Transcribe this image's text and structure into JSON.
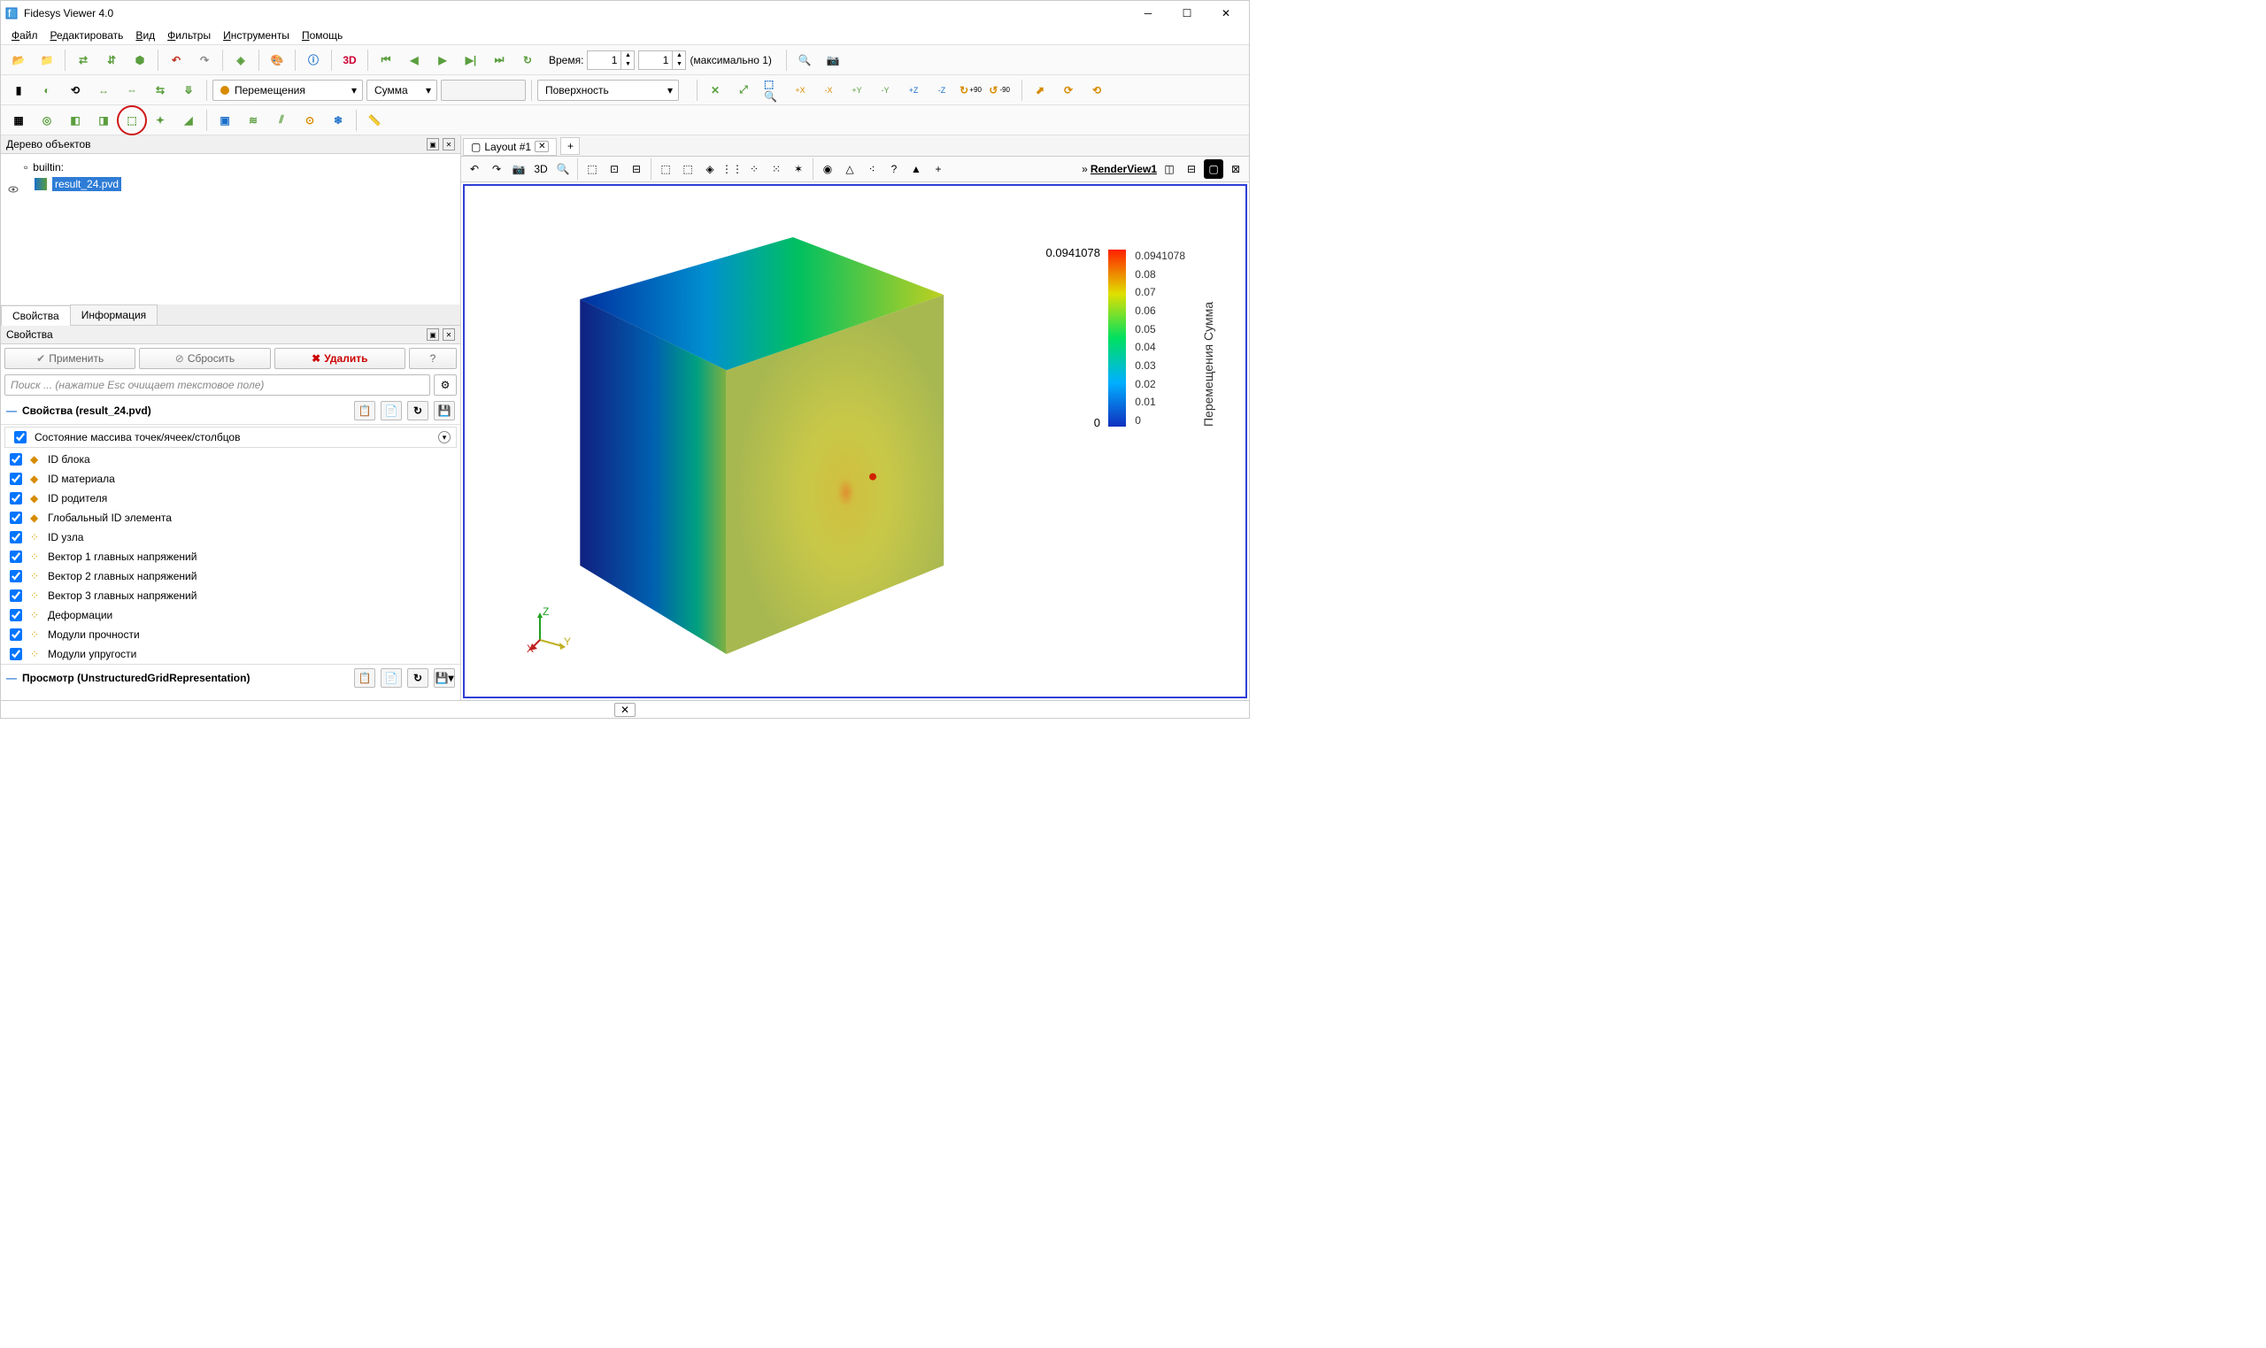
{
  "title": "Fidesys Viewer 4.0",
  "menu": [
    "Файл",
    "Редактировать",
    "Вид",
    "Фильтры",
    "Инструменты",
    "Помощь"
  ],
  "time": {
    "label": "Время:",
    "val1": "1",
    "val2": "1",
    "max": "(максимально 1)"
  },
  "fieldDropdown": "Перемещения",
  "componentDropdown": "Сумма",
  "reprDropdown": "Поверхность",
  "axisBtns": [
    "+X",
    "-X",
    "+Y",
    "-Y",
    "+Z",
    "-Z",
    "+90",
    "-90"
  ],
  "tree": {
    "title": "Дерево объектов",
    "root": "builtin:",
    "item": "result_24.pvd"
  },
  "tabs": {
    "props": "Свойства",
    "info": "Информация"
  },
  "propsTitle": "Свойства",
  "btns": {
    "apply": "Применить",
    "reset": "Сбросить",
    "delete": "Удалить",
    "help": "?"
  },
  "searchPlaceholder": "Поиск ... (нажатие Esc очищает текстовое поле)",
  "section1": "Свойства (result_24.pvd)",
  "arrayHeader": "Состояние массива точек/ячеек/столбцов",
  "arrays": [
    {
      "t": "cell",
      "l": "ID блока"
    },
    {
      "t": "cell",
      "l": "ID материала"
    },
    {
      "t": "cell",
      "l": "ID родителя"
    },
    {
      "t": "cell",
      "l": "Глобальный ID элемента"
    },
    {
      "t": "point",
      "l": "ID узла"
    },
    {
      "t": "point",
      "l": "Вектор 1 главных напряжений"
    },
    {
      "t": "point",
      "l": "Вектор 2 главных напряжений"
    },
    {
      "t": "point",
      "l": "Вектор 3 главных напряжений"
    },
    {
      "t": "point",
      "l": "Деформации"
    },
    {
      "t": "point",
      "l": "Модули прочности"
    },
    {
      "t": "point",
      "l": "Модули упругости"
    }
  ],
  "section2": "Просмотр (UnstructuredGridRepresentation)",
  "layoutTab": "Layout #1",
  "renderView": "RenderView1",
  "threeD": "3D",
  "colorbar": {
    "title": "Перемещения Сумма",
    "max": "0.0941078",
    "maxLeft": "0.0941078",
    "ticks": [
      "0.0941078",
      "0.08",
      "0.07",
      "0.06",
      "0.05",
      "0.04",
      "0.03",
      "0.02",
      "0.01",
      "0"
    ],
    "minLeft": "0"
  },
  "axes": {
    "x": "X",
    "y": "Y",
    "z": "Z"
  },
  "bottomX": "✕"
}
